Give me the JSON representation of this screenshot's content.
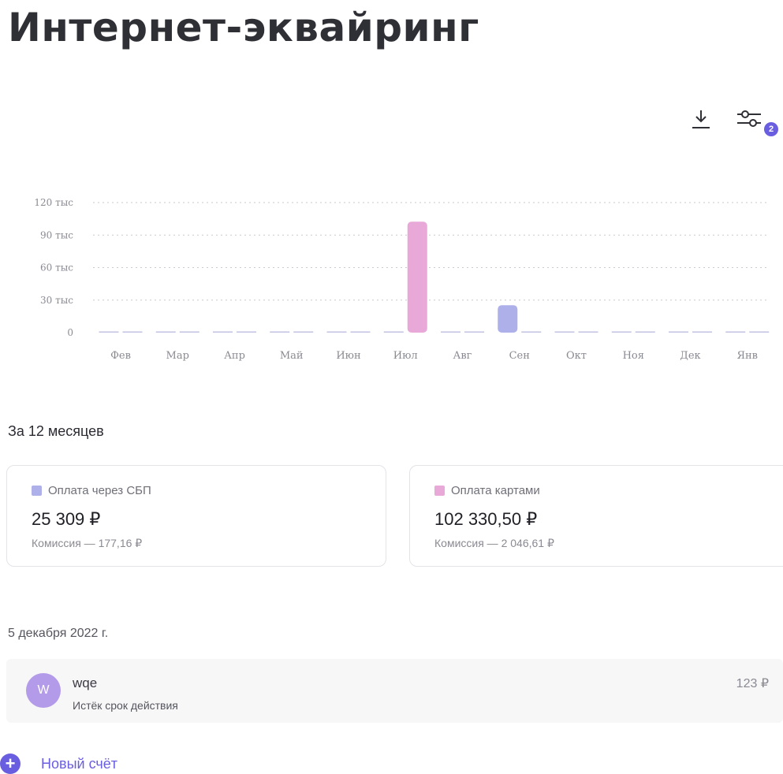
{
  "header": {
    "title": "Интернет-эквайринг"
  },
  "toolbar": {
    "download_icon": "download-icon",
    "filter_icon": "sliders-icon",
    "filter_badge": "2"
  },
  "chart_data": {
    "type": "bar",
    "categories": [
      "Фев",
      "Мар",
      "Апр",
      "Май",
      "Июн",
      "Июл",
      "Авг",
      "Сен",
      "Окт",
      "Ноя",
      "Дек",
      "Янв"
    ],
    "series": [
      {
        "name": "Оплата через СБП",
        "color": "#aeb0ea",
        "values": [
          0,
          0,
          0,
          0,
          0,
          0,
          0,
          25309,
          0,
          0,
          0,
          0
        ]
      },
      {
        "name": "Оплата картами",
        "color": "#e8a8d8",
        "values": [
          0,
          0,
          0,
          0,
          0,
          102330.5,
          0,
          0,
          0,
          0,
          0,
          0
        ]
      }
    ],
    "yticks": [
      "0",
      "30 тыс",
      "60 тыс",
      "90 тыс",
      "120 тыс"
    ],
    "ytick_values": [
      0,
      30000,
      60000,
      90000,
      120000
    ],
    "ylim": [
      0,
      120000
    ],
    "grid": true
  },
  "summary": {
    "title": "За 12 месяцев",
    "sbp": {
      "label": "Оплата через СБП",
      "color": "#aeb0ea",
      "amount": "25 309 ₽",
      "commission": "Комиссия — 177,16 ₽"
    },
    "cards": {
      "label": "Оплата картами",
      "color": "#e8a8d8",
      "amount": "102 330,50 ₽",
      "commission": "Комиссия — 2 046,61 ₽"
    }
  },
  "invoices": {
    "date": "5 декабря 2022 г.",
    "items": [
      {
        "avatar": "W",
        "title": "wqe",
        "status": "Истёк срок действия",
        "amount": "123 ₽"
      }
    ]
  },
  "actions": {
    "new_invoice": "Новый счёт"
  }
}
